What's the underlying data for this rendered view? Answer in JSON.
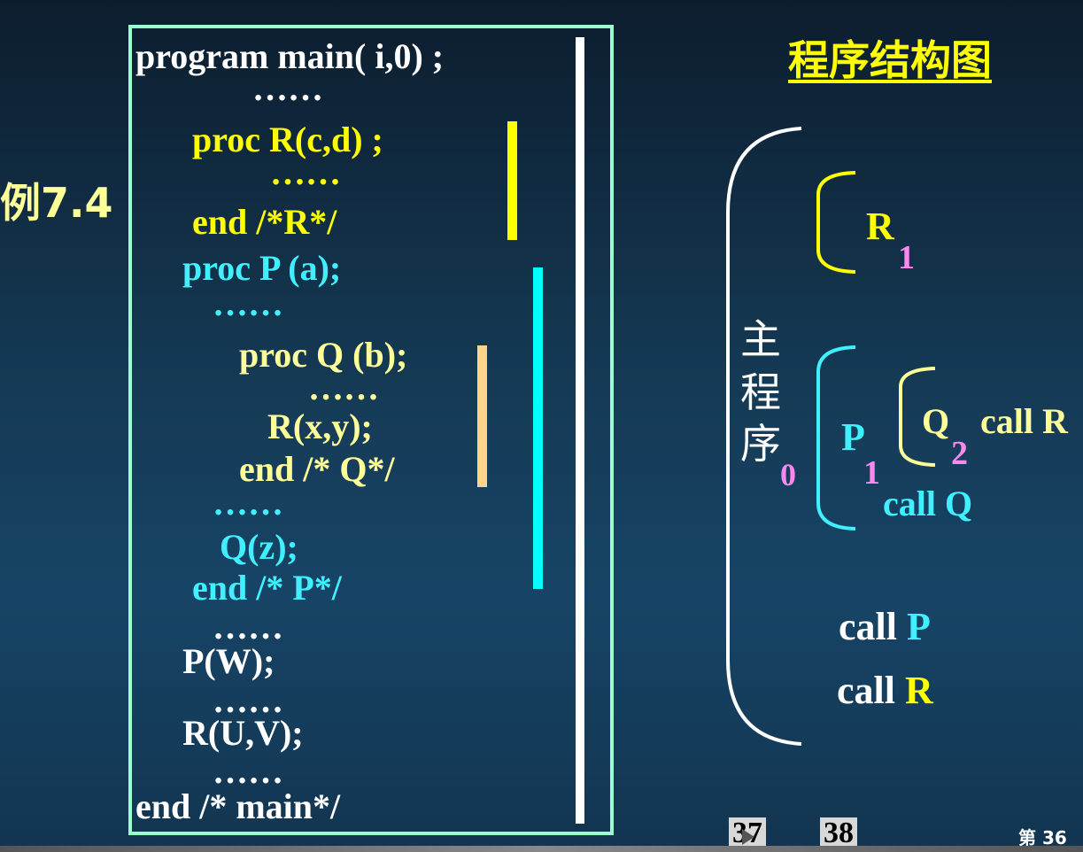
{
  "example_label": "例7.4",
  "code": {
    "lines": [
      "program  main( i,0) ;",
      "……",
      "proc  R(c,d) ;",
      "……",
      "end  /*R*/",
      "proc     P (a);",
      "……",
      "proc   Q (b);",
      "……",
      "R(x,y);",
      "end    /* Q*/",
      "……",
      "Q(z);",
      "end   /* P*/",
      "……",
      "P(W);",
      "……",
      "R(U,V);",
      "……",
      "end   /* main*/"
    ]
  },
  "diagram": {
    "title": "程序结构图",
    "main_label": [
      "主",
      "程",
      "序"
    ],
    "main_level": "0",
    "r_label": "R",
    "r_level": "1",
    "p_label": "P",
    "p_level": "1",
    "q_label": "Q",
    "q_level": "2",
    "q_call": "call R",
    "p_call": "call Q",
    "main_call_p_prefix": "call ",
    "main_call_p_target": "P",
    "main_call_r_prefix": "call ",
    "main_call_r_target": "R"
  },
  "nav": {
    "btn_37": "37",
    "btn_38": "38",
    "page_prefix": "第",
    "page_number": "36"
  },
  "colors": {
    "yellow": "#ffff00",
    "cyan": "#40f0ff",
    "cream": "#ffff99",
    "pink": "#ff88ee",
    "box_border": "#99ffcc"
  }
}
